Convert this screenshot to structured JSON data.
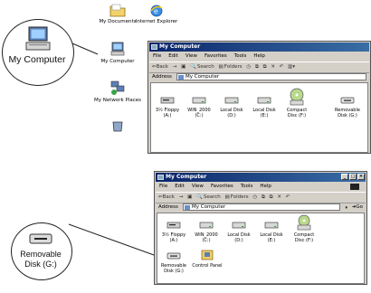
{
  "desktop": {
    "icons": [
      {
        "label": "My Documents",
        "icon": "folder-icon"
      },
      {
        "label": "Internet Explorer",
        "icon": "internet-explorer-icon"
      },
      {
        "label": "My Computer",
        "icon": "computer-icon"
      },
      {
        "label": "My Network Places",
        "icon": "network-places-icon"
      },
      {
        "label": "",
        "icon": "recycle-bin-icon"
      }
    ]
  },
  "callouts": {
    "my_computer": "My Computer",
    "removable": "Removable Disk (G:)"
  },
  "window_top": {
    "title": "My Computer",
    "menu": [
      "File",
      "Edit",
      "View",
      "Favorites",
      "Tools",
      "Help"
    ],
    "toolbar": {
      "back": "⇐Back",
      "search": "Search",
      "folders": "Folders"
    },
    "address_label": "Address",
    "address_value": "My Computer",
    "drives": [
      {
        "label": "3½ Floppy (A:)",
        "icon": "floppy-drive-icon"
      },
      {
        "label": "WIN_2000 (C:)",
        "icon": "hard-disk-icon"
      },
      {
        "label": "Local Disk (D:)",
        "icon": "hard-disk-icon"
      },
      {
        "label": "Local Disk (E:)",
        "icon": "hard-disk-icon"
      },
      {
        "label": "Compact Disc (F:)",
        "icon": "cd-drive-icon"
      },
      {
        "label": "Removable Disk (G:)",
        "icon": "removable-disk-icon"
      }
    ]
  },
  "window_bottom": {
    "title": "My Computer",
    "menu": [
      "File",
      "Edit",
      "View",
      "Favorites",
      "Tools",
      "Help"
    ],
    "toolbar": {
      "back": "⇐Back",
      "search": "Search",
      "folders": "Folders"
    },
    "address_label": "Address",
    "address_value": "My Computer",
    "go": "Go",
    "drives": [
      {
        "label": "3½ Floppy (A:)",
        "icon": "floppy-drive-icon"
      },
      {
        "label": "WIN_2000 (C:)",
        "icon": "hard-disk-icon"
      },
      {
        "label": "Local Disk (D:)",
        "icon": "hard-disk-icon"
      },
      {
        "label": "Local Disk (E:)",
        "icon": "hard-disk-icon"
      },
      {
        "label": "Compact Disc (F:)",
        "icon": "cd-drive-icon"
      },
      {
        "label": "Removable Disk (G:)",
        "icon": "removable-disk-icon"
      },
      {
        "label": "Control Panel",
        "icon": "control-panel-icon"
      }
    ]
  },
  "colors": {
    "titlebar": "#0a246a",
    "window_face": "#d4d0c8",
    "desktop": "#ffffff"
  }
}
